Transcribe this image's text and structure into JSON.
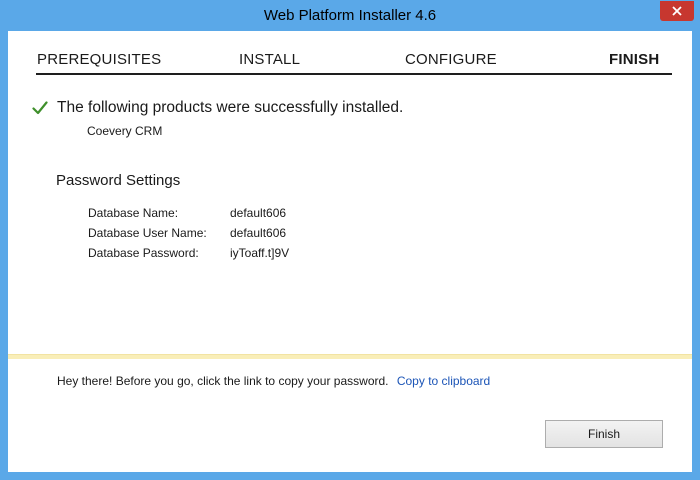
{
  "window": {
    "title": "Web Platform Installer 4.6"
  },
  "steps": [
    {
      "label": "PREREQUISITES",
      "active": false
    },
    {
      "label": "INSTALL",
      "active": false
    },
    {
      "label": "CONFIGURE",
      "active": false
    },
    {
      "label": "FINISH",
      "active": true
    }
  ],
  "result": {
    "message": "The following products were successfully installed.",
    "product": "Coevery CRM"
  },
  "password_settings": {
    "title": "Password Settings",
    "rows": [
      {
        "key": "Database Name:",
        "value": "default606"
      },
      {
        "key": "Database User Name:",
        "value": "default606"
      },
      {
        "key": "Database Password:",
        "value": "iyToaff.t]9V"
      }
    ]
  },
  "notice": {
    "text": "Hey there! Before you go, click the link to copy your password.",
    "link": "Copy to clipboard"
  },
  "buttons": {
    "finish": "Finish"
  },
  "colors": {
    "titlebar": "#5aa8e8",
    "close": "#c7372f",
    "check": "#3f8f2b",
    "link": "#1c55b7",
    "divider": "#f9eeb8"
  },
  "icons": {
    "close": "close-icon",
    "success": "checkmark-icon"
  }
}
